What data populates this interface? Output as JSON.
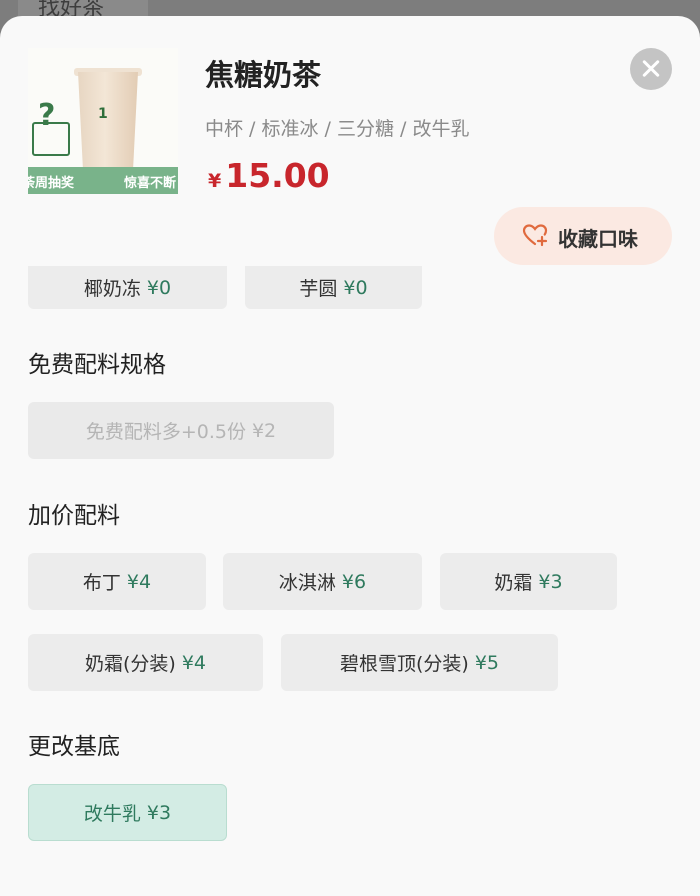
{
  "background": {
    "tab_label": "找好茶"
  },
  "product": {
    "name": "焦糖奶茶",
    "specs": "中杯 / 标准冰 / 三分糖 / 改牛乳",
    "price_symbol": "¥",
    "price": "15.00",
    "image": {
      "promo_left": "荼周抽奖",
      "promo_right": "惊喜不断"
    }
  },
  "favorite": {
    "label": "收藏口味",
    "icon": "heart-plus-icon"
  },
  "close_icon": "close-icon",
  "partial_options": [
    {
      "name": "椰奶冻",
      "price": "¥0"
    },
    {
      "name": "芋圆",
      "price": "¥0"
    }
  ],
  "sections": {
    "free_spec": {
      "title": "免费配料规格",
      "options": [
        {
          "name": "免费配料多+0.5份",
          "price": "¥2",
          "state": "disabled"
        }
      ]
    },
    "paid": {
      "title": "加价配料",
      "options": [
        {
          "name": "布丁",
          "price": "¥4"
        },
        {
          "name": "冰淇淋",
          "price": "¥6"
        },
        {
          "name": "奶霜",
          "price": "¥3"
        },
        {
          "name": "奶霜(分装)",
          "price": "¥4"
        },
        {
          "name": "碧根雪顶(分装)",
          "price": "¥5"
        }
      ]
    },
    "base": {
      "title": "更改基底",
      "options": [
        {
          "name": "改牛乳",
          "price": "¥3",
          "state": "selected"
        }
      ]
    }
  },
  "colors": {
    "price": "#c8262c",
    "option_price": "#2f7a5e",
    "selected_bg": "#d3ece4",
    "favorite_bg": "#fbe9e2"
  }
}
